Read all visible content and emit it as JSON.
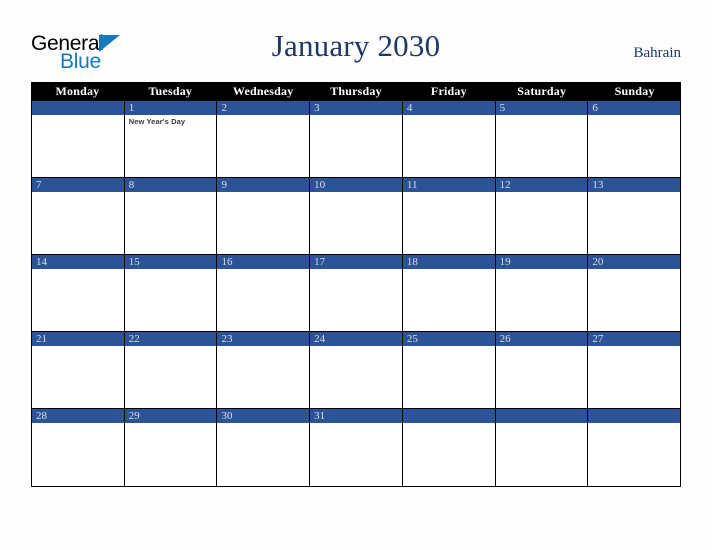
{
  "brand": {
    "name_top": "General",
    "name_bottom": "Blue",
    "accent_color": "#1479bd"
  },
  "header": {
    "title": "January 2030",
    "country": "Bahrain",
    "title_color": "#1f3864"
  },
  "theme": {
    "weekday_bar_bg": "#000000",
    "weekday_bar_text": "#ffffff",
    "date_bar_bg": "#2b5396",
    "date_bar_text": "#d9dfee",
    "cell_bg": "#ffffff",
    "grid_line": "#000000",
    "page_bg": "#fdfdfd"
  },
  "weekdays": [
    "Monday",
    "Tuesday",
    "Wednesday",
    "Thursday",
    "Friday",
    "Saturday",
    "Sunday"
  ],
  "weeks": [
    [
      {
        "date": "",
        "events": []
      },
      {
        "date": "1",
        "events": [
          "New Year's Day"
        ]
      },
      {
        "date": "2",
        "events": []
      },
      {
        "date": "3",
        "events": []
      },
      {
        "date": "4",
        "events": []
      },
      {
        "date": "5",
        "events": []
      },
      {
        "date": "6",
        "events": []
      }
    ],
    [
      {
        "date": "7",
        "events": []
      },
      {
        "date": "8",
        "events": []
      },
      {
        "date": "9",
        "events": []
      },
      {
        "date": "10",
        "events": []
      },
      {
        "date": "11",
        "events": []
      },
      {
        "date": "12",
        "events": []
      },
      {
        "date": "13",
        "events": []
      }
    ],
    [
      {
        "date": "14",
        "events": []
      },
      {
        "date": "15",
        "events": []
      },
      {
        "date": "16",
        "events": []
      },
      {
        "date": "17",
        "events": []
      },
      {
        "date": "18",
        "events": []
      },
      {
        "date": "19",
        "events": []
      },
      {
        "date": "20",
        "events": []
      }
    ],
    [
      {
        "date": "21",
        "events": []
      },
      {
        "date": "22",
        "events": []
      },
      {
        "date": "23",
        "events": []
      },
      {
        "date": "24",
        "events": []
      },
      {
        "date": "25",
        "events": []
      },
      {
        "date": "26",
        "events": []
      },
      {
        "date": "27",
        "events": []
      }
    ],
    [
      {
        "date": "28",
        "events": []
      },
      {
        "date": "29",
        "events": []
      },
      {
        "date": "30",
        "events": []
      },
      {
        "date": "31",
        "events": []
      },
      {
        "date": "",
        "events": []
      },
      {
        "date": "",
        "events": []
      },
      {
        "date": "",
        "events": []
      }
    ]
  ]
}
